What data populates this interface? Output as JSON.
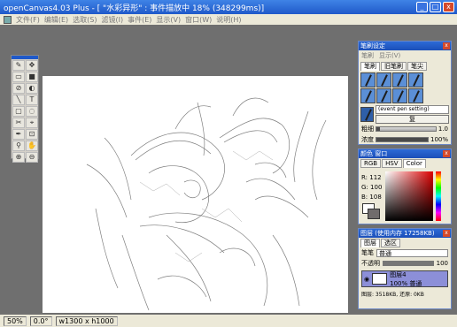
{
  "window": {
    "title": "openCanvas4.03 Plus - [ \"水彩异形\" : 事件描放中 18% (348299ms)]",
    "min": "_",
    "max": "□",
    "close": "x"
  },
  "menu": [
    "文件(F)",
    "编辑(E)",
    "选取(S)",
    "滤镜(I)",
    "事件(E)",
    "显示(V)",
    "窗口(W)",
    "说明(H)"
  ],
  "status": {
    "zoom": "50%",
    "angle": "0.0°",
    "size": "w1300 x h1000"
  },
  "brush_panel": {
    "title": "笔刷设定",
    "submenu": [
      "笔刷",
      "显示(V)"
    ],
    "tabs": [
      "笔刷",
      "旧笔刷",
      "笔尖"
    ],
    "active_tab": 0,
    "preset_name": "(event pen setting)",
    "restore_label": "复",
    "size_label": "粗细",
    "size_value": "1.0",
    "size_fraction": 0.06,
    "density_label": "浓度",
    "density_value": "100%",
    "density_fraction": 1.0
  },
  "color_panel": {
    "title": "颜色 窗口",
    "tabs": [
      "RGB",
      "HSV",
      "Color"
    ],
    "active_tab": 2,
    "r_label": "R:",
    "r": "112",
    "g_label": "G:",
    "g": "100",
    "b_label": "B:",
    "b": "108",
    "current_color": "#706c6c"
  },
  "layer_panel": {
    "title": "图层 (使用内存 17258KB)",
    "tabs": [
      "图层",
      "选区"
    ],
    "mode_label": "笔笔",
    "mode_value": "普通",
    "opacity_label": "不透明",
    "opacity_value": "100",
    "layer_name": "图层4",
    "layer_sub": "100% 普通",
    "footer": "图层: 3518KB, 还原: 0KB"
  },
  "tools": [
    "✎",
    "✥",
    "▭",
    "■",
    "⊘",
    "◐",
    "╲",
    "T",
    "▢",
    "◌",
    "✂",
    "⌖",
    "✒",
    "⊡",
    "⚲",
    "✋",
    "⊕",
    "⊖"
  ]
}
